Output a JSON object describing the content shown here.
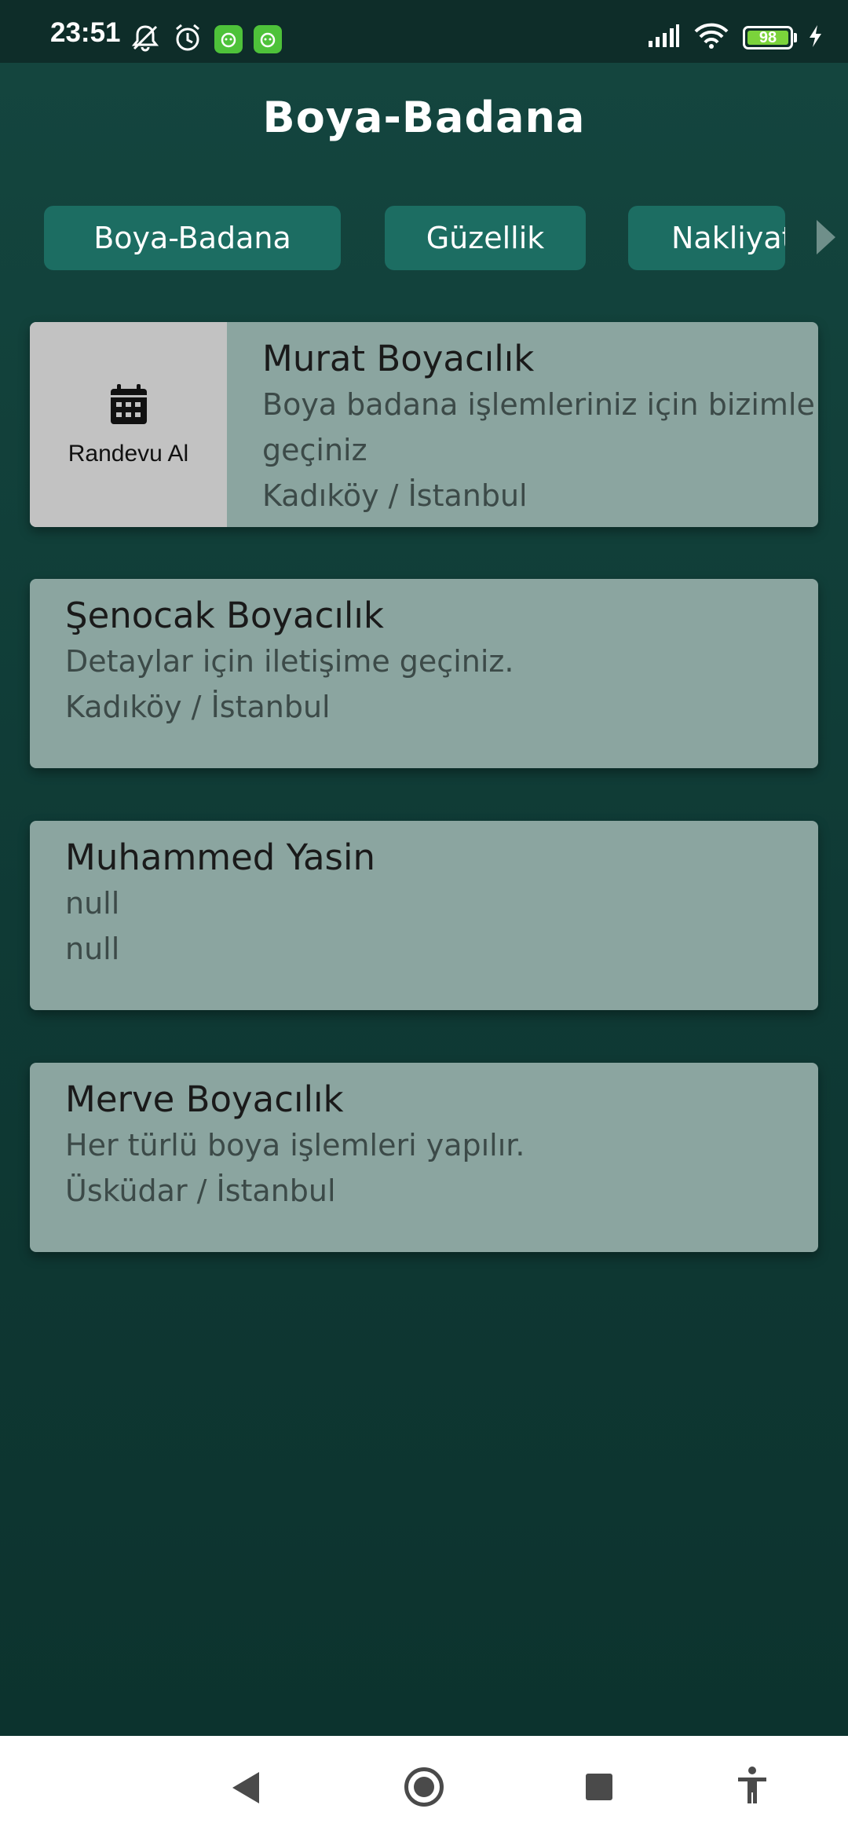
{
  "status_bar": {
    "time": "23:51",
    "battery": "98",
    "icons": [
      "mute-icon",
      "alarm-icon",
      "app-icon",
      "app-icon",
      "signal-icon",
      "wifi-icon",
      "battery-icon",
      "charging-icon"
    ]
  },
  "header": {
    "title": "Boya-Badana"
  },
  "tabs": [
    {
      "label": "Boya-Badana"
    },
    {
      "label": "Güzellik"
    },
    {
      "label": "Nakliyat"
    }
  ],
  "listings": [
    {
      "title": "Murat Boyacılık",
      "description": "Boya badana işlemleriniz için bizimle iletişime geçiniz",
      "description_line1": "Boya badana işlemleriniz için bizimle",
      "description_line2": "geçiniz",
      "location": "Kadıköy / İstanbul",
      "action_label": "Randevu Al",
      "action_icon": "calendar-icon"
    },
    {
      "title": "Şenocak Boyacılık",
      "description": "Detaylar için iletişime geçiniz.",
      "location": "Kadıköy / İstanbul"
    },
    {
      "title": "Muhammed Yasin",
      "description": "null",
      "location": "null"
    },
    {
      "title": "Merve Boyacılık",
      "description": "Her türlü boya işlemleri yapılır.",
      "location": "Üsküdar / İstanbul"
    }
  ],
  "colors": {
    "background": "#0f3a35",
    "tab": "#1c6d62",
    "card": "#8ba5a0",
    "swipe_action": "#c2c2c2"
  }
}
